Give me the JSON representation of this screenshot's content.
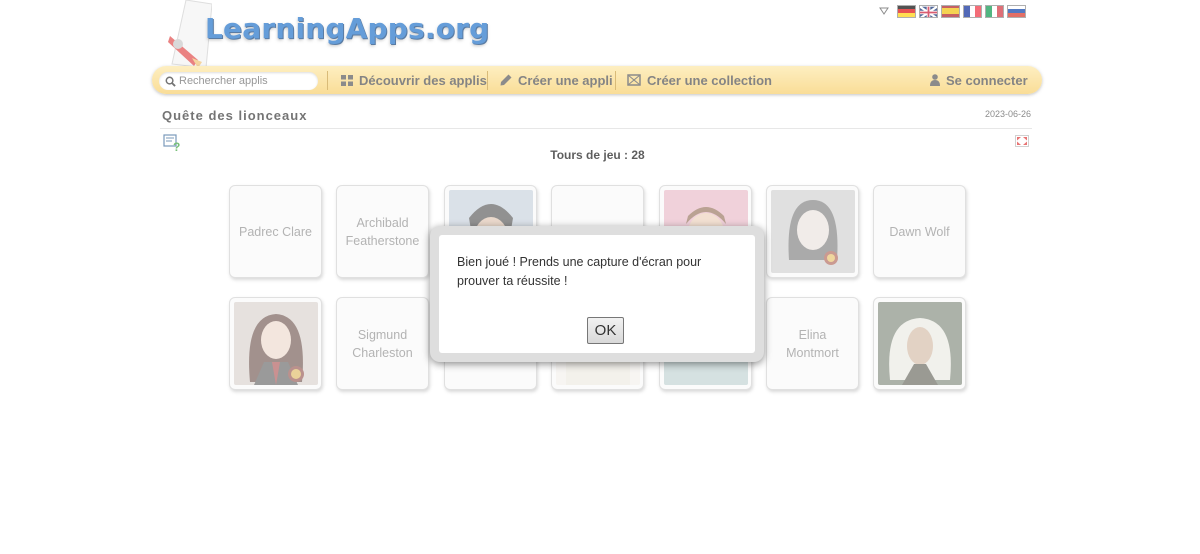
{
  "site": {
    "logo_text": "LearningApps.org"
  },
  "languages": [
    {
      "code": "de",
      "colors": [
        "#000000",
        "#dd0000",
        "#ffce00"
      ],
      "layout": "h"
    },
    {
      "code": "en",
      "colors": [
        "#012169",
        "#ffffff",
        "#c8102e"
      ],
      "layout": "uk"
    },
    {
      "code": "es",
      "colors": [
        "#aa151b",
        "#f1bf00",
        "#aa151b"
      ],
      "layout": "h"
    },
    {
      "code": "fr",
      "colors": [
        "#002395",
        "#ffffff",
        "#ed2939"
      ],
      "layout": "v"
    },
    {
      "code": "it",
      "colors": [
        "#009246",
        "#ffffff",
        "#ce2b37"
      ],
      "layout": "v"
    },
    {
      "code": "ru",
      "colors": [
        "#ffffff",
        "#0039a6",
        "#d52b1e"
      ],
      "layout": "h"
    }
  ],
  "nav": {
    "search_placeholder": "Rechercher applis",
    "discover_label": "Découvrir des applis",
    "create_label": "Créer une appli",
    "collection_label": "Créer une collection",
    "login_label": "Se connecter"
  },
  "app": {
    "title": "Quête des lionceaux",
    "date": "2023-06-26",
    "rounds_label": "Tours de jeu : 28"
  },
  "cards": [
    {
      "type": "text",
      "text": "Padrec Clare"
    },
    {
      "type": "text",
      "text": "Archibald Featherstone"
    },
    {
      "type": "image",
      "icon": "portrait-man-dark-hair"
    },
    {
      "type": "blank"
    },
    {
      "type": "image",
      "icon": "portrait-man-glasses"
    },
    {
      "type": "image",
      "icon": "portrait-woman-grey"
    },
    {
      "type": "text",
      "text": "Dawn Wolf"
    },
    {
      "type": "image",
      "icon": "portrait-girl-uniform"
    },
    {
      "type": "text",
      "text": "Sigmund Charleston"
    },
    {
      "type": "blank"
    },
    {
      "type": "image",
      "icon": "portrait-faded"
    },
    {
      "type": "image",
      "icon": "portrait-faded-teal"
    },
    {
      "type": "text",
      "text": "Elina Montmort"
    },
    {
      "type": "image",
      "icon": "portrait-old-man-white-hair"
    }
  ],
  "dialog": {
    "message": "Bien joué ! Prends une capture d'écran pour prouver ta réussite !",
    "ok_label": "OK"
  },
  "colors": {
    "nav_bar": "#f7cd66",
    "logo_blue": "#1d6fc7"
  }
}
